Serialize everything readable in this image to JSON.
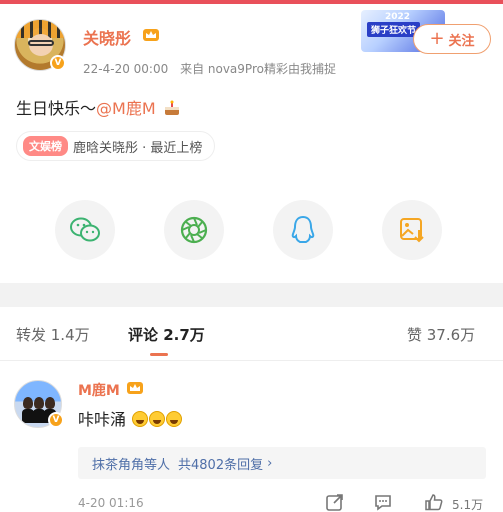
{
  "post": {
    "author": "关晓彤",
    "timestamp": "22-4-20 00:00",
    "source": "来自 nova9Pro精彩由我捕捉",
    "event_banner": {
      "year": "2022",
      "title": "狮子狂欢节"
    },
    "follow_label": "关注",
    "text_prefix": "生日快乐～",
    "mention": "@M鹿M",
    "rank_tag": "文娱榜",
    "rank_text": "鹿晗关晓彤 · 最近上榜"
  },
  "share": {
    "items": [
      "wechat-icon",
      "moments-icon",
      "qq-icon",
      "save-image-icon"
    ],
    "colors": {
      "wechat": "#3cb371",
      "moments": "#4caf50",
      "qq": "#3aa7e8",
      "save": "#f5a623"
    }
  },
  "tabs": {
    "repost": "转发 1.4万",
    "comments": "评论 2.7万",
    "likes": "赞 37.6万"
  },
  "comment": {
    "author": "M鹿M",
    "text": "咔咔涌",
    "replies_user": "抹茶角角等人",
    "replies_count": "共4802条回复",
    "time": "4-20 01:16",
    "like_count": "5.1万"
  },
  "colors": {
    "accent": "#eb7350",
    "link": "#4f6fa8",
    "vip": "#f7a21b"
  }
}
